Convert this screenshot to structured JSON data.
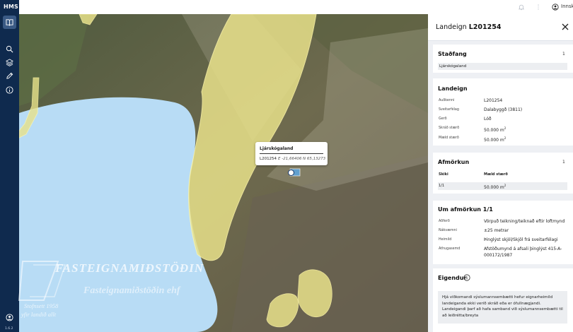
{
  "app": {
    "logo": "HMS",
    "version": "1.6.2"
  },
  "topbar": {
    "login_label": "Innskr"
  },
  "sidebar": {
    "items": [
      {
        "name": "map-layers",
        "icon": "book-open-icon",
        "active": true
      },
      {
        "name": "search",
        "icon": "search-icon"
      },
      {
        "name": "layers",
        "icon": "layers-icon"
      },
      {
        "name": "draw",
        "icon": "pencil-icon"
      },
      {
        "name": "info",
        "icon": "info-icon"
      },
      {
        "name": "account",
        "icon": "user-circle-icon"
      }
    ]
  },
  "map": {
    "popup": {
      "title": "Ljárskógaland",
      "id": "L201254",
      "coord_e": "E -21,66406",
      "coord_n": "N 65,13273"
    },
    "watermark": {
      "line1": "FASTEIGNAMIÐSTÖÐIN",
      "line2": "Fasteignamiðstöðin ehf",
      "line3": "Stofnsett 1958",
      "line4": "yfir landið allt"
    }
  },
  "panel": {
    "title_prefix": "Landeign",
    "title_id": "L201254",
    "stadfang": {
      "heading": "Staðfang",
      "count": "1",
      "value": "Ljárskógaland"
    },
    "landeign": {
      "heading": "Landeign",
      "rows": [
        {
          "label": "Auðkenni",
          "value": "L201254"
        },
        {
          "label": "Sveitarfélag",
          "value": "Dalabyggð (3811)"
        },
        {
          "label": "Gerð",
          "value": "Lóð"
        },
        {
          "label": "Skráð stærð",
          "value": "50.000 m",
          "sup": "2"
        },
        {
          "label": "Mæld stærð",
          "value": "50.000 m",
          "sup": "2"
        }
      ]
    },
    "afmorkun": {
      "heading": "Afmörkun",
      "count": "1",
      "col1": "Skiki",
      "col2": "Mæld stærð",
      "row_skiki": "1/1",
      "row_value": "50.000 m",
      "row_sup": "2"
    },
    "um_afmorkun": {
      "heading": "Um afmörkun 1/1",
      "rows": [
        {
          "label": "Aðferð",
          "value": "Vörpuð teikning/teiknað eftir loftmynd"
        },
        {
          "label": "Nákvæmni",
          "value": "±25 metrar"
        },
        {
          "label": "Heimild",
          "value": "Þinglýst skjöl/Skjöl frá sveitarfélagi"
        },
        {
          "label": "Athugasemd",
          "value": "Afstöðumynd á afsali þinglýst 415-A-000172/1987"
        }
      ]
    },
    "eigendur": {
      "heading": "Eigendur",
      "note": "Hjá viðkomandi sýslumannsembætti hefur eignarheimild landeiganda ekki verið skráð eða er ófullnægjandi. Landeigandi þarf að hafa samband við sýslumannsembætti til að leiðrétta/breyta"
    }
  },
  "colors": {
    "sidebar": "#0f2a4e",
    "lake": "#b8dcf5",
    "parcel": "#e8e18a",
    "panel_bg": "#eef0f4"
  }
}
